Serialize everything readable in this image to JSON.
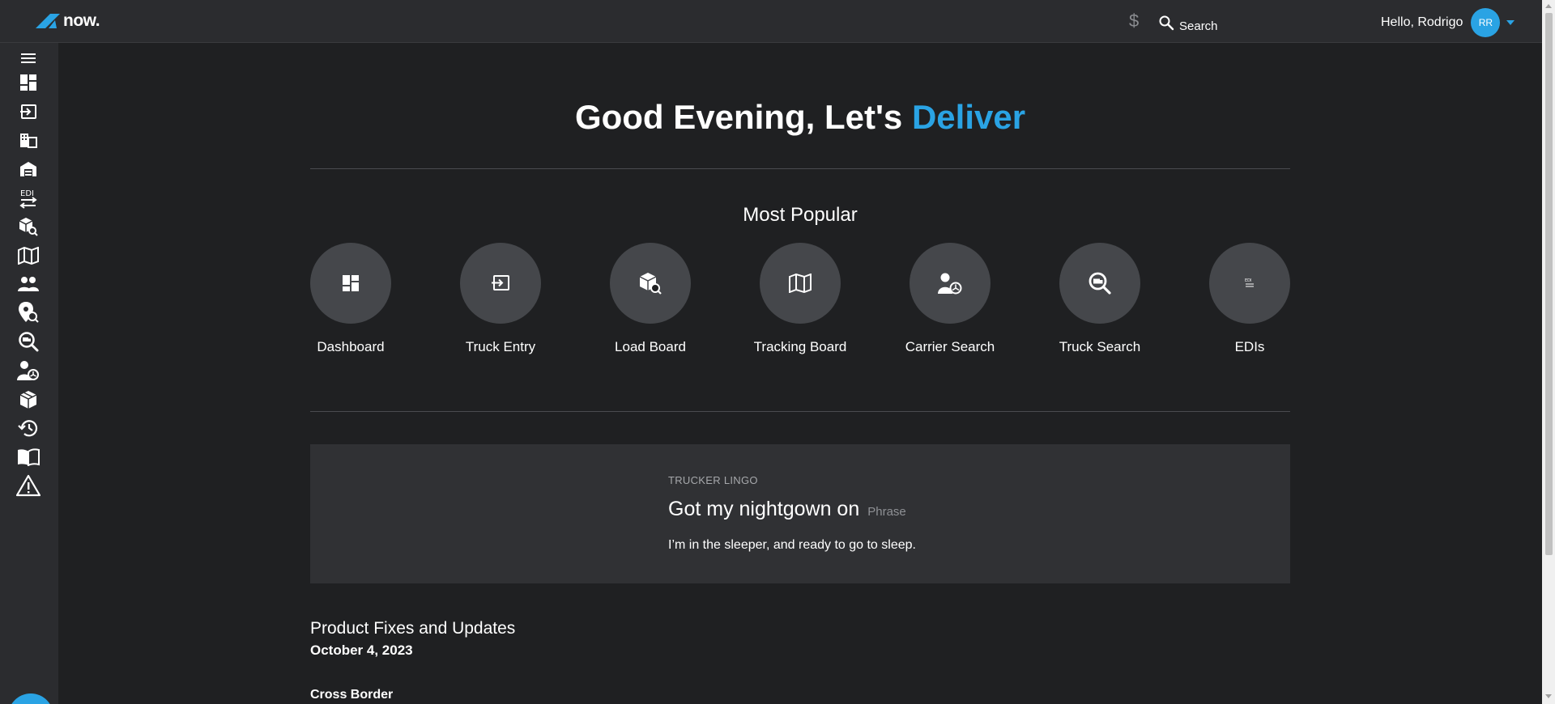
{
  "header": {
    "logo_text": "now.",
    "currency_symbol": "$",
    "search_label": "Search",
    "greeting_user": "Hello, Rodrigo",
    "avatar_initials": "RR"
  },
  "sidebar": {
    "items": [
      {
        "icon": "menu-icon"
      },
      {
        "icon": "dashboard-icon"
      },
      {
        "icon": "truck-entry-icon"
      },
      {
        "icon": "building-icon"
      },
      {
        "icon": "warehouse-icon"
      },
      {
        "icon": "edi-icon",
        "label": "EDI"
      },
      {
        "icon": "load-search-icon"
      },
      {
        "icon": "map-icon"
      },
      {
        "icon": "people-icon"
      },
      {
        "icon": "location-search-icon"
      },
      {
        "icon": "truck-search-icon"
      },
      {
        "icon": "carrier-icon"
      },
      {
        "icon": "package-icon"
      },
      {
        "icon": "history-icon"
      },
      {
        "icon": "book-icon"
      },
      {
        "icon": "warning-icon"
      }
    ],
    "help_label": "?"
  },
  "main": {
    "greeting_prefix": "Good Evening, Let's ",
    "greeting_accent": "Deliver",
    "popular_title": "Most Popular",
    "tiles": [
      {
        "label": "Dashboard",
        "icon": "dashboard-icon"
      },
      {
        "label": "Truck Entry",
        "icon": "truck-entry-icon"
      },
      {
        "label": "Load Board",
        "icon": "load-board-icon"
      },
      {
        "label": "Tracking Board",
        "icon": "map-icon"
      },
      {
        "label": "Carrier Search",
        "icon": "carrier-icon"
      },
      {
        "label": "Truck Search",
        "icon": "truck-search-icon"
      },
      {
        "label": "EDIs",
        "icon": "edi-icon"
      }
    ],
    "lingo": {
      "kicker": "TRUCKER LINGO",
      "title": "Got my nightgown on",
      "type": "Phrase",
      "description": "I’m in the sleeper, and ready to go to sleep."
    },
    "updates": {
      "title": "Product Fixes and Updates",
      "date": "October 4, 2023",
      "section": "Cross Border"
    }
  },
  "colors": {
    "accent": "#2aa3e4",
    "background": "#1f2022",
    "panel": "#2b2c2f",
    "tile": "#45474b"
  }
}
